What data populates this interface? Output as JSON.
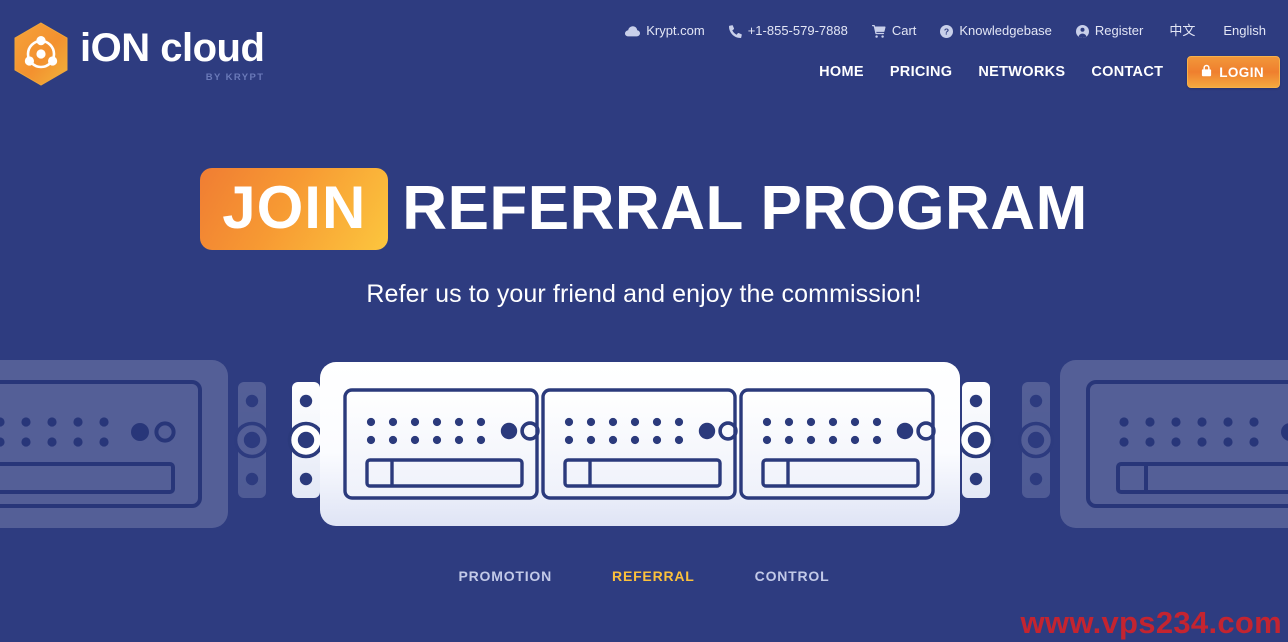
{
  "theme": {
    "background": "#2e3c80",
    "accent_orange": "#f2973a",
    "accent_yellow": "#fcc13c",
    "text_light": "#ffffff",
    "muted": "#c3cae8",
    "rack_stroke": "#2b3a7c",
    "watermark_red": "#d1232a"
  },
  "header": {
    "logo": {
      "name_part1": "iON",
      "name_part2": "cloud",
      "tagline": "BY KRYPT",
      "icon": "hexagon-atom-icon"
    },
    "utility_links": [
      {
        "label": "Krypt.com",
        "icon": "cloud-icon"
      },
      {
        "label": "+1-855-579-7888",
        "icon": "phone-icon"
      },
      {
        "label": "Cart",
        "icon": "cart-icon"
      },
      {
        "label": "Knowledgebase",
        "icon": "question-circle-icon"
      },
      {
        "label": "Register",
        "icon": "user-circle-icon"
      },
      {
        "label": "中文",
        "icon": ""
      },
      {
        "label": "English",
        "icon": ""
      }
    ],
    "nav_links": [
      {
        "label": "HOME"
      },
      {
        "label": "PRICING"
      },
      {
        "label": "NETWORKS"
      },
      {
        "label": "CONTACT"
      }
    ],
    "login": {
      "label": "LOGIN",
      "icon": "lock-icon"
    }
  },
  "hero": {
    "badge": "JOIN",
    "title_rest": "REFERRAL PROGRAM",
    "subtitle": "Refer us to your friend and enjoy the commission!"
  },
  "illustration": {
    "name": "server-rack-illustration",
    "units_per_rack": 3,
    "dot_columns": 6,
    "dot_rows": 2
  },
  "tabs": [
    {
      "label": "PROMOTION",
      "active": false
    },
    {
      "label": "REFERRAL",
      "active": true
    },
    {
      "label": "CONTROL",
      "active": false
    }
  ],
  "watermark": "www.vps234.com"
}
